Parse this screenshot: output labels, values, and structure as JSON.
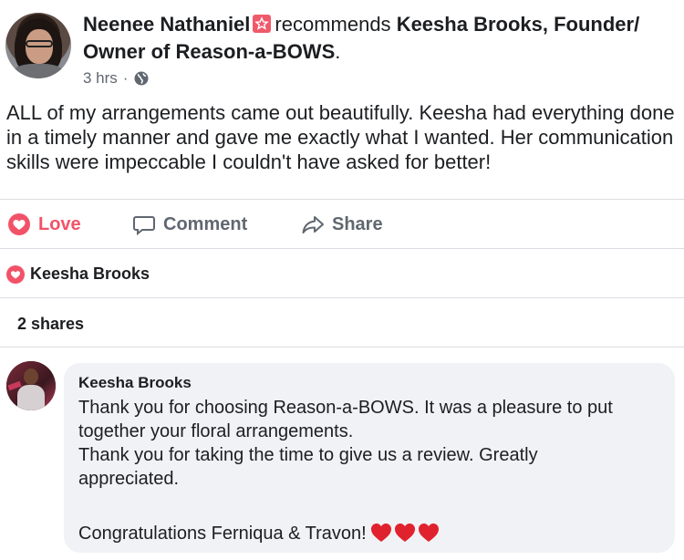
{
  "post": {
    "author_name": "Neenee Nathaniel",
    "verb": "recommends",
    "target": "Keesha Brooks, Founder/",
    "target_line2": "Owner of Reason-a-BOWS",
    "target_suffix": ".",
    "time": "3 hrs",
    "separator": "·",
    "privacy_icon": "globe-icon",
    "body": "ALL of my arrangements came out beautifully. Keesha had everything done in a timely manner and gave me exactly what I wanted. Her communication skills were impeccable I couldn't have asked for better!"
  },
  "actions": {
    "love_label": "Love",
    "comment_label": "Comment",
    "share_label": "Share"
  },
  "reactions": {
    "icon": "heart-icon",
    "name": "Keesha Brooks"
  },
  "shares_text": "2 shares",
  "comment": {
    "author": "Keesha Brooks",
    "line1": "Thank you for choosing Reason-a-BOWS. It was a pleasure to put",
    "line2": "together your floral arrangements.",
    "line3": "Thank you for taking the time to give us a review. Greatly",
    "line4": "appreciated.",
    "line5": "Congratulations Ferniqua & Travon!",
    "emoji": "red-heart-emoji x3"
  },
  "colors": {
    "love_red": "#f25268",
    "recommend_badge": "#ef5a6b",
    "secondary_text": "#606770",
    "bubble_bg": "#f0f2f5",
    "divider": "#dadde1"
  }
}
